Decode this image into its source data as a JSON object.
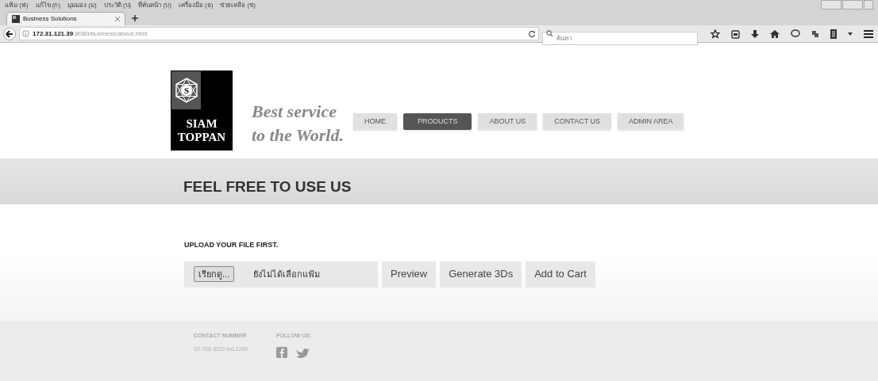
{
  "menu_bar": [
    "แฟ้ม (ฟ)",
    "แก้ไข (ก)",
    "มุมมอง (ม)",
    "ประวัติ (ป)",
    "ที่คั่นหน้า (บ)",
    "เครื่องมือ (อ)",
    "ช่วยเหลือ (ช)"
  ],
  "tabs": [
    {
      "title": "Business Solutions",
      "selected": true
    }
  ],
  "address_bar": {
    "host": "172.31.121.39",
    "path": ":8080/business/about.html"
  },
  "search": {
    "placeholder": "ค้นหา"
  },
  "logo": {
    "line_1": "SIAM",
    "line_2": "TOPPAN",
    "letter": "S"
  },
  "tagline": {
    "line_1": "Best service",
    "line_2": "to the World."
  },
  "nav": [
    {
      "label": "HOME",
      "selected": false
    },
    {
      "label": "PRODUCTS",
      "selected": true
    },
    {
      "label": "ABOUT US",
      "selected": false
    },
    {
      "label": "CONTACT US",
      "selected": false
    },
    {
      "label": "ADMIN AREA",
      "selected": false
    }
  ],
  "banner": "FEEL FREE TO USE US",
  "upload": {
    "label": "UPLOAD YOUR FILE FIRST.",
    "browse_button": "เรียกดู...",
    "file_status": "ยังไม่ได้เลือกแฟ้ม",
    "buttons": [
      "Preview",
      "Generate 3Ds",
      "Add to Cart"
    ]
  },
  "footer": {
    "contact_heading": "CONTACT NUMBER",
    "contact_number": "02-709-3110 ext.1200",
    "follow_heading": "FOLLOW US:"
  }
}
